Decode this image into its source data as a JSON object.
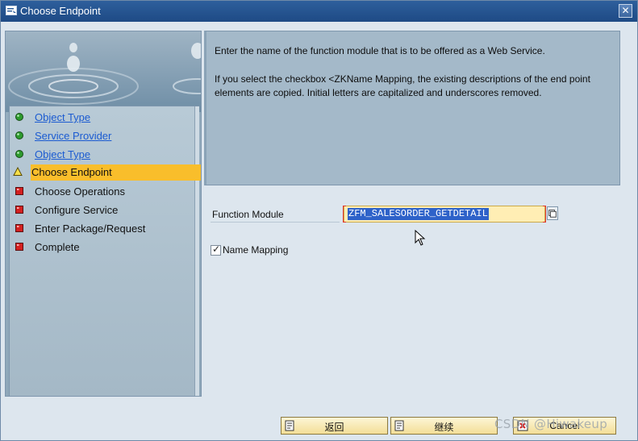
{
  "window": {
    "title": "Choose Endpoint",
    "close_icon": "close-icon"
  },
  "wizard": {
    "steps": [
      {
        "label": "Object Type",
        "status": "done",
        "style": "link"
      },
      {
        "label": "Service Provider",
        "status": "done",
        "style": "link"
      },
      {
        "label": "Object Type",
        "status": "done",
        "style": "link"
      },
      {
        "label": "Choose Endpoint",
        "status": "current",
        "style": "active"
      },
      {
        "label": "Choose Operations",
        "status": "pending",
        "style": "plain"
      },
      {
        "label": "Configure Service",
        "status": "pending",
        "style": "plain"
      },
      {
        "label": "Enter Package/Request",
        "status": "pending",
        "style": "plain"
      },
      {
        "label": "Complete",
        "status": "pending",
        "style": "plain"
      }
    ]
  },
  "info": {
    "line1": "Enter the name of the function module that is to be offered as a Web Service.",
    "line2": "If you select the checkbox <ZKName Mapping, the existing descriptions of the end point elements are copied. Initial letters are capitalized and underscores removed."
  },
  "form": {
    "function_module_label": "Function Module",
    "function_module_value": "ZFM_SALESORDER_GETDETAIL",
    "name_mapping_label": "Name Mapping",
    "name_mapping_checked": true
  },
  "buttons": {
    "back_label": "返回",
    "continue_label": "继续",
    "cancel_label": "Cancel"
  },
  "watermark": "CSDN @Hiwakeup",
  "colors": {
    "titlebar": "#1e4a85",
    "active_step": "#f9be2b",
    "link": "#1b5bd1",
    "input_bg": "#ffeeb4",
    "selection": "#2e62c9"
  }
}
